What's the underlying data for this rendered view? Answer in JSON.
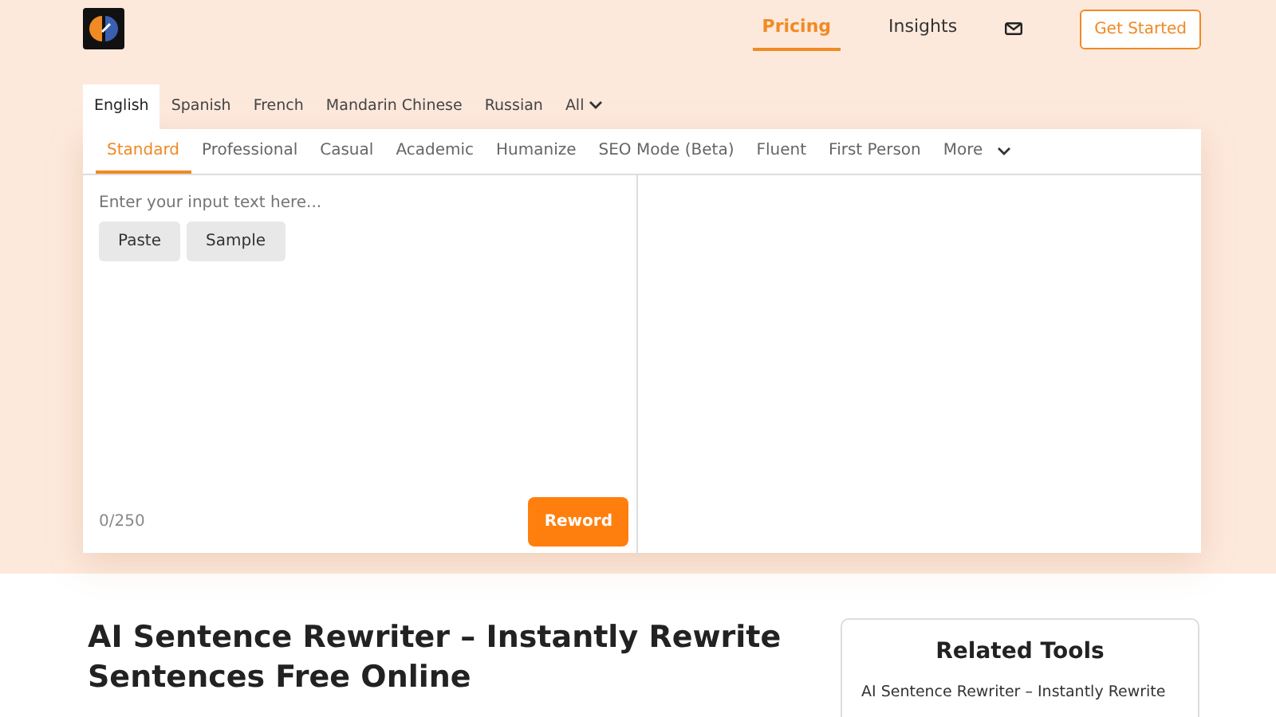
{
  "nav": {
    "links": [
      {
        "label": "Pricing",
        "selected": true
      },
      {
        "label": "Insights",
        "selected": false
      }
    ],
    "cta": "Get Started"
  },
  "languages": [
    {
      "label": "English",
      "selected": true
    },
    {
      "label": "Spanish",
      "selected": false
    },
    {
      "label": "French",
      "selected": false
    },
    {
      "label": "Mandarin Chinese",
      "selected": false
    },
    {
      "label": "Russian",
      "selected": false
    },
    {
      "label": "All",
      "selected": false
    }
  ],
  "modes": [
    {
      "label": "Standard",
      "selected": true
    },
    {
      "label": "Professional",
      "selected": false
    },
    {
      "label": "Casual",
      "selected": false
    },
    {
      "label": "Academic",
      "selected": false
    },
    {
      "label": "Humanize",
      "selected": false
    },
    {
      "label": "SEO Mode (Beta)",
      "selected": false
    },
    {
      "label": "Fluent",
      "selected": false
    },
    {
      "label": "First Person",
      "selected": false
    },
    {
      "label": "More",
      "selected": false
    }
  ],
  "input": {
    "placeholder": "Enter your input text here...",
    "buttons": [
      "Paste",
      "Sample"
    ],
    "counter": "0/250",
    "submit": "Reword"
  },
  "article": {
    "title": "AI Sentence Rewriter – Instantly Rewrite Sentences Free Online"
  },
  "related": {
    "title": "Related Tools",
    "items": [
      "AI Sentence Rewriter – Instantly Rewrite"
    ]
  }
}
